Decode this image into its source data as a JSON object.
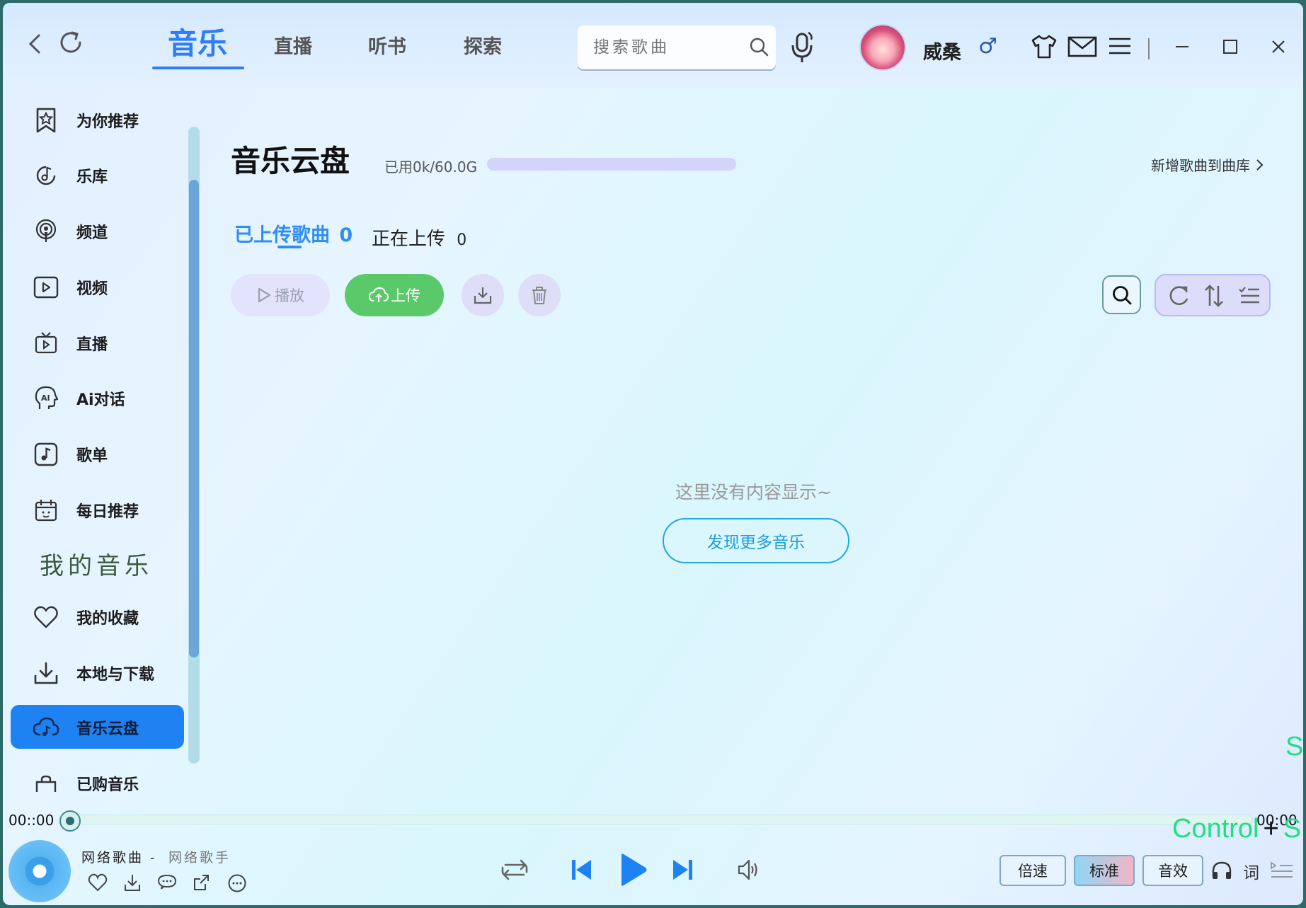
{
  "titlebar": {
    "tabs": [
      "音乐",
      "直播",
      "听书",
      "探索"
    ],
    "search_placeholder": "搜索歌曲",
    "user_name": "威桑",
    "gender_symbol": "♂"
  },
  "sidebar": {
    "items": [
      {
        "label": "为你推荐",
        "icon": "star-bookmark-icon"
      },
      {
        "label": "乐库",
        "icon": "music-note-disc-icon"
      },
      {
        "label": "频道",
        "icon": "podcast-icon"
      },
      {
        "label": "视频",
        "icon": "video-icon"
      },
      {
        "label": "直播",
        "icon": "tv-icon"
      },
      {
        "label": "Ai对话",
        "icon": "ai-head-icon"
      },
      {
        "label": "歌单",
        "icon": "playlist-icon"
      },
      {
        "label": "每日推荐",
        "icon": "calendar-icon"
      }
    ],
    "section_title": "我的音乐",
    "my_items": [
      {
        "label": "我的收藏",
        "icon": "heart-icon"
      },
      {
        "label": "本地与下载",
        "icon": "download-icon"
      },
      {
        "label": "音乐云盘",
        "icon": "cloud-music-icon",
        "active": true
      },
      {
        "label": "已购音乐",
        "icon": "shopping-bag-icon"
      }
    ]
  },
  "main": {
    "title": "音乐云盘",
    "storage_text": "已用0k/60.0G",
    "storage_used_fraction": 0,
    "add_link": "新增歌曲到曲库",
    "tab_uploaded_label": "已上传歌曲",
    "tab_uploaded_count": "0",
    "tab_uploading_label": "正在上传",
    "tab_uploading_count": "0",
    "play_label": "播放",
    "upload_label": "上传",
    "empty_text": "这里没有内容显示~",
    "discover_label": "发现更多音乐"
  },
  "player": {
    "time_current": "00::00",
    "time_total": "00:00",
    "progress_fraction": 0,
    "song_title": "网络歌曲 -",
    "song_artist": "网络歌手",
    "speed_label": "倍速",
    "quality_label": "标准",
    "effect_label": "音效",
    "lyrics_label": "词"
  },
  "overlay": {
    "s_label": "S",
    "control_label": "Control",
    "plus": "+",
    "s2_label": "S"
  },
  "colors": {
    "accent": "#2f7df7",
    "active_sidebar": "#1f82f2",
    "upload_green": "#59c969"
  }
}
